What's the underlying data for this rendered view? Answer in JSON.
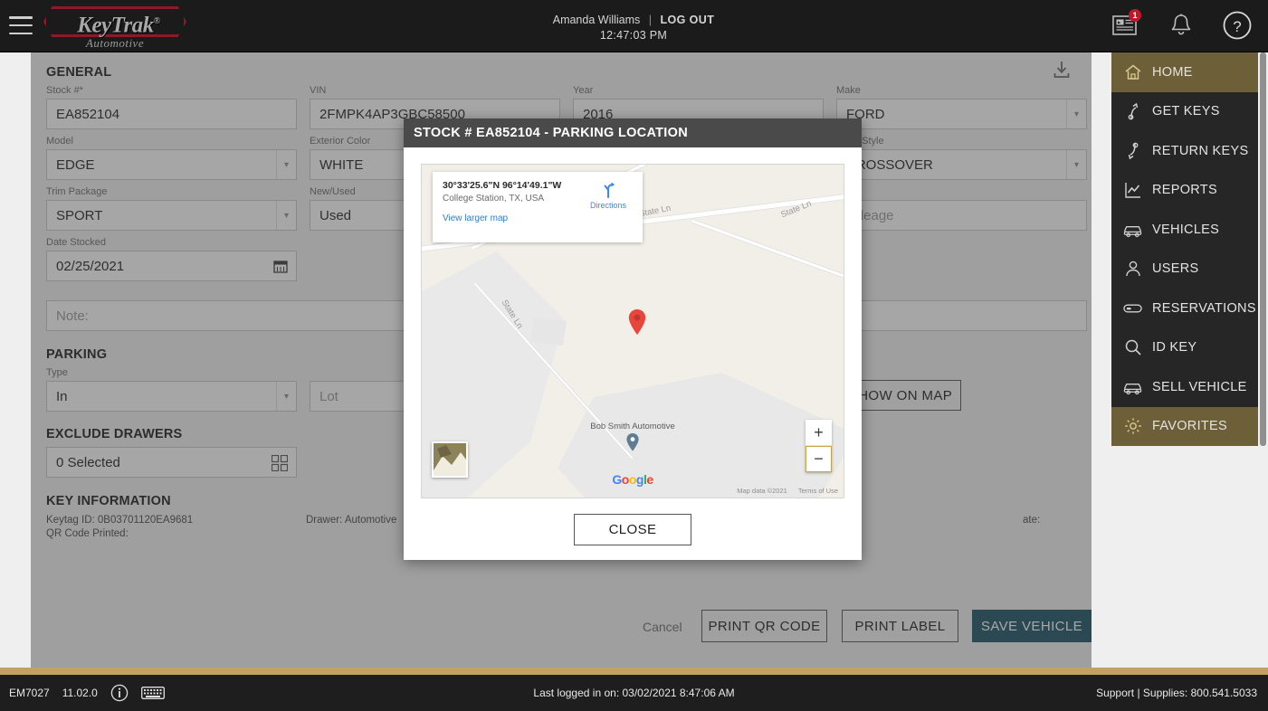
{
  "topbar": {
    "menu_icon": "hamburger-icon",
    "logo_text": "KeyTrak",
    "logo_registered": "®",
    "logo_sub": "Automotive",
    "user_name": "Amanda Williams",
    "separator": "|",
    "logout_label": "LOG OUT",
    "clock": "12:47:03 PM",
    "icons": [
      {
        "name": "messages-icon",
        "badge": "1"
      },
      {
        "name": "bell-icon",
        "badge": ""
      },
      {
        "name": "help-icon",
        "badge": ""
      }
    ]
  },
  "sidebar": {
    "items": [
      {
        "label": "HOME",
        "icon": "home-icon",
        "active": true
      },
      {
        "label": "GET KEYS",
        "icon": "key-up-arrow-icon",
        "active": false
      },
      {
        "label": "RETURN KEYS",
        "icon": "key-down-arrow-icon",
        "active": false
      },
      {
        "label": "REPORTS",
        "icon": "chart-icon",
        "active": false
      },
      {
        "label": "VEHICLES",
        "icon": "car-icon",
        "active": false
      },
      {
        "label": "USERS",
        "icon": "user-icon",
        "active": false
      },
      {
        "label": "RESERVATIONS",
        "icon": "keytag-icon",
        "active": false
      },
      {
        "label": "ID KEY",
        "icon": "magnifier-icon",
        "active": false
      },
      {
        "label": "SELL VEHICLE",
        "icon": "car-icon",
        "active": false
      },
      {
        "label": "FAVORITES",
        "icon": "gear-icon",
        "active": true
      }
    ]
  },
  "main": {
    "general_heading": "GENERAL",
    "download_icon": "download-icon",
    "fields": {
      "stock": {
        "label": "Stock #*",
        "value": "EA852104"
      },
      "vin": {
        "label": "VIN",
        "value": "2FMPK4AP3GBC58500"
      },
      "year": {
        "label": "Year",
        "value": "2016"
      },
      "make": {
        "label": "Make",
        "value": "FORD"
      },
      "model": {
        "label": "Model",
        "value": "EDGE"
      },
      "exterior_color": {
        "label": "Exterior Color",
        "value": "WHITE"
      },
      "body_style": {
        "label": "Body Style",
        "value": "CROSSOVER"
      },
      "trim_package": {
        "label": "Trim Package",
        "value": "SPORT"
      },
      "new_used": {
        "label": "New/Used",
        "value": "Used"
      },
      "mileage": {
        "label": "Mileage",
        "value": "",
        "placeholder": "Mileage"
      },
      "date_stocked": {
        "label": "Date Stocked",
        "value": "02/25/2021",
        "icon": "calendar-icon"
      },
      "note": {
        "label": "",
        "value": "",
        "placeholder": "Note:"
      }
    },
    "parking_heading": "PARKING",
    "parking": {
      "type": {
        "label": "Type",
        "value": "In"
      },
      "lot": {
        "label": "",
        "value": "",
        "placeholder": "Lot"
      },
      "show_on_map_label": "SHOW ON MAP"
    },
    "exclude_heading": "EXCLUDE DRAWERS",
    "exclude": {
      "value": "0 Selected",
      "icon": "grid-icon"
    },
    "key_info_heading": "KEY INFORMATION",
    "key_info": {
      "keytag": "Keytag ID: 0B03701120EA9681",
      "qr": "QR Code Printed:",
      "drawer": "Drawer: Automotive",
      "date": "ate:"
    },
    "footer_actions": {
      "cancel": "Cancel",
      "print_qr": "PRINT QR CODE",
      "print_label": "PRINT LABEL",
      "save": "SAVE VEHICLE"
    }
  },
  "modal": {
    "title": "STOCK # EA852104 - PARKING LOCATION",
    "close_label": "CLOSE",
    "map": {
      "coords": "30°33'25.6\"N 96°14'49.1\"W",
      "place": "College Station, TX, USA",
      "view_larger": "View larger map",
      "directions_label": "Directions",
      "directions_icon": "directions-icon",
      "pin_icon": "map-pin-icon",
      "poi_name": "Bob Smith Automotive",
      "poi_icon": "map-marker-icon",
      "road_labels": [
        "State Ln",
        "State Ln",
        "State Ln"
      ],
      "zoom_in": "+",
      "zoom_out": "−",
      "satellite_toggle": "satellite-thumbnail",
      "brand": "Google",
      "brand_letters": [
        "G",
        "o",
        "o",
        "g",
        "l",
        "e"
      ],
      "attribution": "Map data ©2021",
      "terms": "Terms of Use"
    }
  },
  "statusbar": {
    "terminal": "EM7027",
    "version": "11.02.0",
    "info_icon": "info-icon",
    "keyboard_icon": "keyboard-icon",
    "last_login": "Last logged in on: 03/02/2021 8:47:06 AM",
    "support": "Support | Supplies: 800.541.5033"
  },
  "colors": {
    "accent_gold": "#6d5f37",
    "gold_line": "#c0a263",
    "primary_button": "#1e5567",
    "badge_red": "#c0182a",
    "logo_red": "#8e1a26",
    "nav_bg": "#262626",
    "topbar_bg": "#1b1b1b"
  }
}
